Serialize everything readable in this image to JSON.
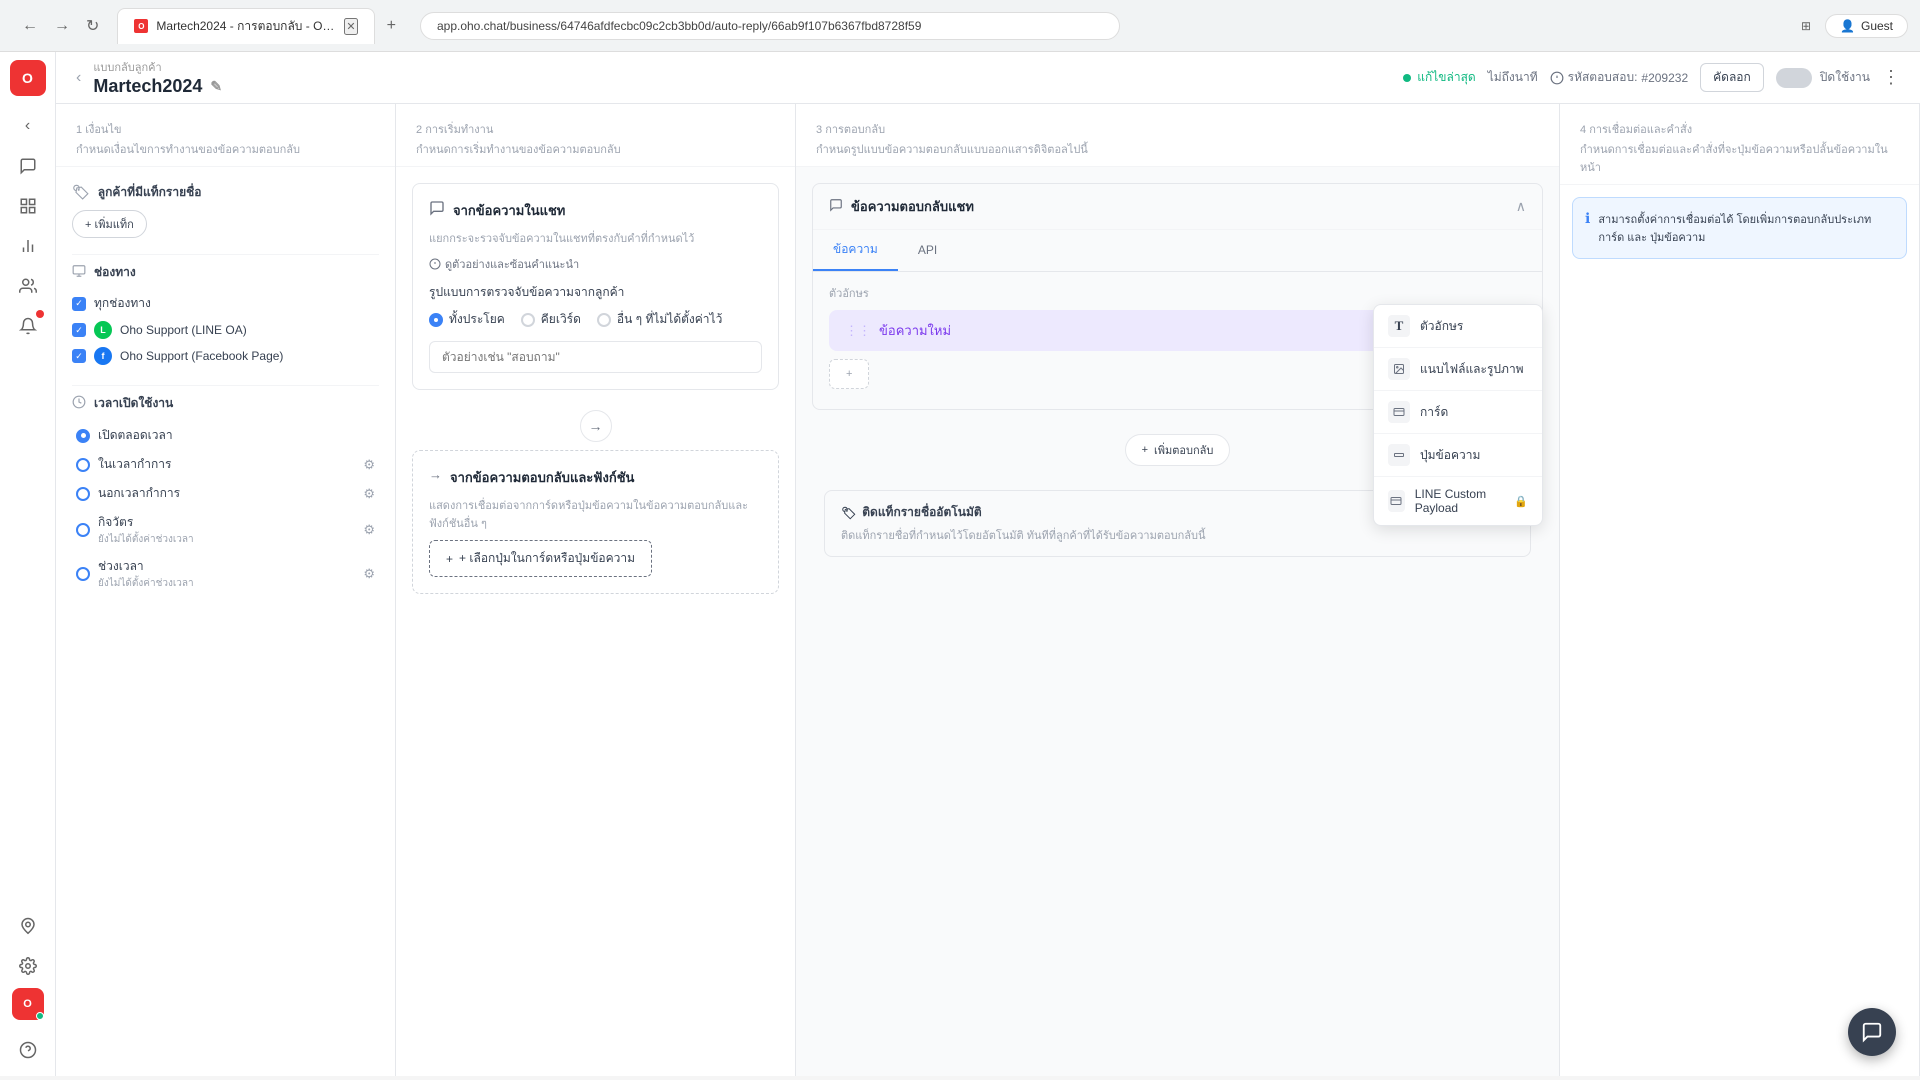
{
  "browser": {
    "tab_label": "Martech2024 - การตอบกลับ - Oh...",
    "favicon_color": "#e33",
    "address": "app.oho.chat/business/64746afdfecbc09c2cb3bb0d/auto-reply/66ab9f107b6367fbd8728f59",
    "nav_back": "←",
    "nav_forward": "→",
    "nav_refresh": "↻",
    "guest_label": "Guest",
    "translate_icon": "⊞",
    "add_tab": "+"
  },
  "header": {
    "breadcrumb": "แบบกลับลูกค้า",
    "title": "Martech2024",
    "edit_icon": "✎",
    "status_label": "แก้ไขล่าสุด",
    "not_saved_label": "ไม่ถึงนาที",
    "code_prefix": "รหัสตอบสอบ:",
    "code_value": "#209232",
    "copy_label": "คัดลอก",
    "toggle_label": "ปิดใช้งาน",
    "more_icon": "⋮"
  },
  "step1": {
    "number": "1",
    "title": "เงื่อนไข",
    "desc": "กำหนดเงื่อนไขการทำงานของข้อความตอบกลับ",
    "tag_section_label": "ลูกค้าที่มีแท็กรายชื่อ",
    "tag_icon": "🏷",
    "add_tag_label": "+ เพิ่มแท็ก",
    "channel_label": "ช่องทาง",
    "channel_icon": "⊞",
    "channels": [
      {
        "name": "ทุกช่องทาง",
        "checked": true,
        "type": "all"
      },
      {
        "name": "Oho Support (LINE OA)",
        "checked": true,
        "type": "line"
      },
      {
        "name": "Oho Support (Facebook Page)",
        "checked": true,
        "type": "fb"
      }
    ],
    "time_label": "เวลาเปิดใช้งาน",
    "time_icon": "⏰",
    "time_options": [
      {
        "label": "เปิดตลอดเวลา",
        "checked": true,
        "sub": ""
      },
      {
        "label": "ในเวลากำการ",
        "checked": false,
        "sub": ""
      },
      {
        "label": "นอกเวลากำการ",
        "checked": false,
        "sub": ""
      },
      {
        "label": "กิจวัตร",
        "checked": false,
        "sub": "ยังไม่ได้ตั้งค่าช่วงเวลา"
      },
      {
        "label": "ช่วงเวลา",
        "checked": false,
        "sub": "ยังไม่ได้ตั้งค่าช่วงเวลา"
      }
    ]
  },
  "step2": {
    "number": "2",
    "title": "การเริ่มทำงาน",
    "desc": "กำหนดการเริ่มทำงานของข้อความตอบกลับ",
    "trigger_card": {
      "icon": "💬",
      "title": "จากข้อความในแชท",
      "desc": "แยกกระจะรวจจับข้อความในแชทที่ตรงกับคำที่กำหนดไว้",
      "info_label": "ดูตัวอย่างและซ้อนคำแนะนำ",
      "check_format_label": "รูปแบบการตรวจจับข้อความจากลูกค้า",
      "radio_options": [
        {
          "label": "ทั้งประโยค",
          "checked": true
        },
        {
          "label": "คียเวิร์ด",
          "checked": false
        },
        {
          "label": "อื่น ๆ ที่ไม่ได้ตั้งค่าไว้",
          "checked": false
        }
      ],
      "placeholder": "ตัวอย่างเช่น \"สอบถาม\""
    },
    "trigger_card2": {
      "icon": "→",
      "title": "จากข้อความตอบกลับและฟังก์ชัน",
      "desc": "แสดงการเชื่อมต่อจากการ์ดหรือปุ่มข้อความในข้อความตอบกลับและฟังก์ชันอื่น ๆ",
      "add_btn_label": "+ เลือกปุ่มในการ์ดหรือปุ่มข้อความ"
    }
  },
  "step3": {
    "number": "3",
    "title": "การตอบกลับ",
    "desc": "กำหนดรูปแบบข้อความตอบกลับแบบออกแสารดิจิตอลไปนี้",
    "response_card_title": "ข้อความตอบกลับแชท",
    "tab_message": "ข้อความ",
    "tab_api": "API",
    "variable_label": "ตัวอักษร",
    "message_bubble_text": "ข้อความใหม่",
    "add_bottom_label": "เพิ่มตอบกลับ",
    "dropdown_items": [
      {
        "icon": "T",
        "label": "ตัวอักษร",
        "locked": false
      },
      {
        "icon": "🖼",
        "label": "แนบไฟล์และรูปภาพ",
        "locked": false
      },
      {
        "icon": "▦",
        "label": "การ์ด",
        "locked": false
      },
      {
        "icon": "⬜",
        "label": "ปุ่มข้อความ",
        "locked": false
      },
      {
        "icon": "▦",
        "label": "LINE Custom Payload",
        "locked": true
      }
    ],
    "auto_tag_title": "ติดแท็กรายชื่ออัตโนมัติ",
    "auto_tag_icon": "🏷",
    "auto_tag_desc": "ติดแท็กรายชื่อที่กำหนดไว้โดยอัตโนมัติ ทันทีที่ลูกค้าที่ได้รับข้อความตอบกลับนี้"
  },
  "step4": {
    "number": "4",
    "title": "การเชื่อมต่อและคำสั่ง",
    "desc": "กำหนดการเชื่อมต่อและคำสั่งที่จะปุ่มข้อความหรือปลั้นข้อความในหน้า",
    "info_text": "สามารถตั้งค่าการเชื่อมต่อได้ โดยเพิ่มการตอบกลับประเภทการ์ด และ ปุ่มข้อความ"
  },
  "icons": {
    "tag": "🏷",
    "channel": "📡",
    "clock": "🕐",
    "chat": "💬",
    "arrow": "→",
    "collapse": "∧",
    "expand": "∨",
    "drag": "⋮⋮",
    "add": "+",
    "gear": "⚙",
    "info": "ℹ",
    "lock": "🔒",
    "back": "‹",
    "check": "✓",
    "chat_bubble": "💬"
  }
}
